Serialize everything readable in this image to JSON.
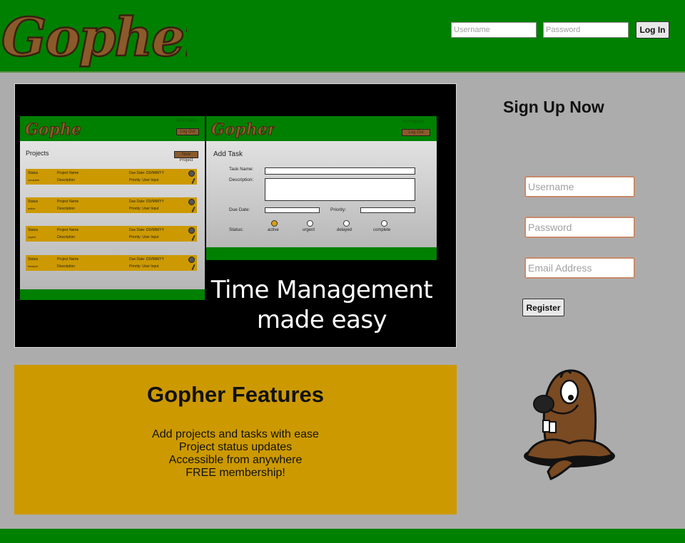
{
  "header": {
    "logo_text": "Gopher",
    "username_placeholder": "Username",
    "password_placeholder": "Password",
    "login_label": "Log In"
  },
  "hero": {
    "tagline_line1": "Time Management",
    "tagline_line2": "made easy",
    "mock_projects": {
      "logo_text": "Gopher",
      "link_text": "All Projects",
      "logout_label": "Log Out",
      "heading": "Projects",
      "new_project_label": "New Project",
      "cards": [
        {
          "status_label": "Status",
          "status_value": "complete",
          "name": "Project Name",
          "description": "Description",
          "due": "Due Date: DD/MM/YY",
          "priority": "Priority: User Input"
        },
        {
          "status_label": "Status",
          "status_value": "active",
          "name": "Project Name",
          "description": "Description",
          "due": "Due Date: DD/MM/YY",
          "priority": "Priority: User Input"
        },
        {
          "status_label": "Status",
          "status_value": "urgent",
          "name": "Project Name",
          "description": "Description",
          "due": "Due Date: DD/MM/YY",
          "priority": "Priority: User Input"
        },
        {
          "status_label": "Status",
          "status_value": "delayed",
          "name": "Project Name",
          "description": "Description",
          "due": "Due Date: DD/MM/YY",
          "priority": "Priority: User Input"
        }
      ]
    },
    "mock_task": {
      "logo_text": "Gopher",
      "link_text": "All Projects",
      "logout_label": "Log Out",
      "heading": "Add Task",
      "task_name_label": "Task Name:",
      "description_label": "Description:",
      "due_date_label": "Due Date:",
      "priority_label": "Priority:",
      "status_label": "Status:",
      "status_options": [
        "active",
        "urgent",
        "delayed",
        "complete"
      ],
      "selected_status": "active"
    }
  },
  "features": {
    "title": "Gopher Features",
    "items": [
      "Add projects and tasks with ease",
      "Project status updates",
      "Accessible from anywhere",
      "FREE membership!"
    ]
  },
  "signup": {
    "title": "Sign Up Now",
    "username_placeholder": "Username",
    "password_placeholder": "Password",
    "email_placeholder": "Email Address",
    "register_label": "Register"
  },
  "colors": {
    "header_green": "#008000",
    "background_gray": "#acacac",
    "features_gold": "#cc9900",
    "logo_brown": "#8b5a2b"
  }
}
